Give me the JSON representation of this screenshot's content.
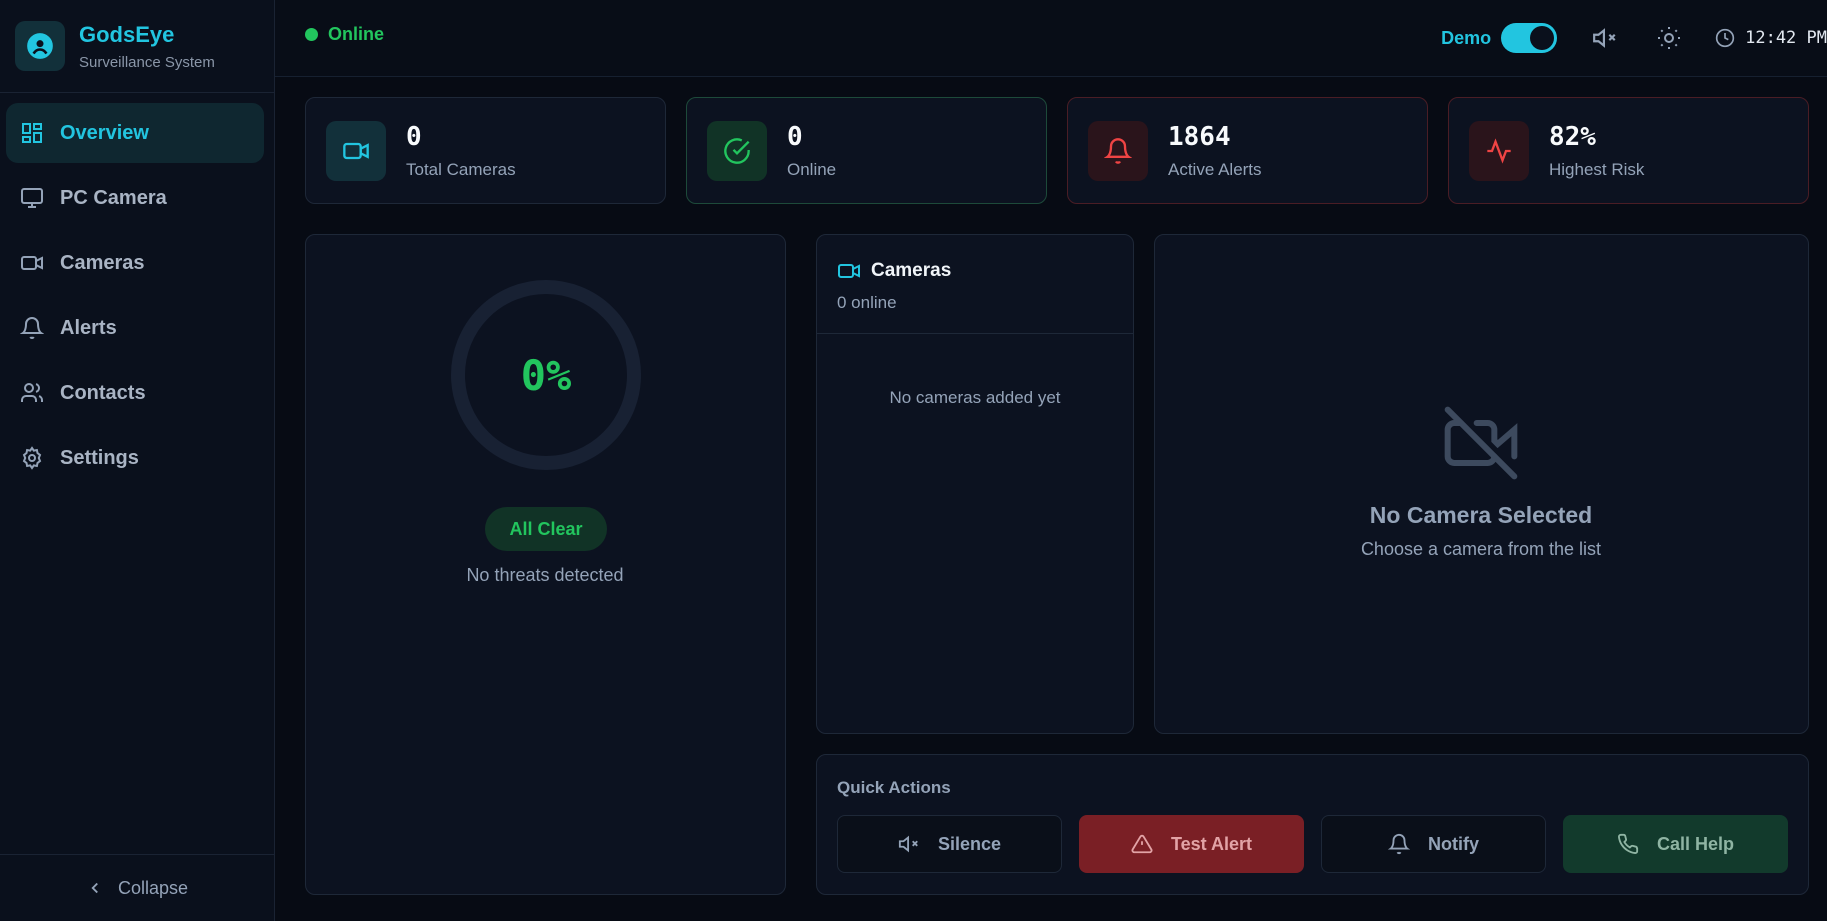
{
  "brand": {
    "name": "GodsEye",
    "subtitle": "Surveillance System"
  },
  "nav": [
    {
      "label": "Overview",
      "icon": "layout-grid-icon",
      "active": true
    },
    {
      "label": "PC Camera",
      "icon": "monitor-icon"
    },
    {
      "label": "Cameras",
      "icon": "video-icon"
    },
    {
      "label": "Alerts",
      "icon": "bell-icon"
    },
    {
      "label": "Contacts",
      "icon": "users-icon"
    },
    {
      "label": "Settings",
      "icon": "gear-icon"
    }
  ],
  "collapse_label": "Collapse",
  "header": {
    "status": "Online",
    "demo_label": "Demo",
    "demo_enabled": true,
    "time": "12:42 PM"
  },
  "stats": [
    {
      "value": "0",
      "label": "Total Cameras",
      "icon": "video-icon",
      "color": "#22c5e0"
    },
    {
      "value": "0",
      "label": "Online",
      "icon": "check-circle-icon",
      "color": "#22c55e"
    },
    {
      "value": "1864",
      "label": "Active Alerts",
      "icon": "bell-icon",
      "color": "#ef4444"
    },
    {
      "value": "82%",
      "label": "Highest Risk",
      "icon": "activity-icon",
      "color": "#ef4444"
    }
  ],
  "threat": {
    "percent_text": "0%",
    "level": 0,
    "status": "All Clear",
    "message": "No threats detected"
  },
  "cameras": {
    "title": "Cameras",
    "online_text": "0 online",
    "empty_text": "No cameras added yet"
  },
  "viewer": {
    "title": "No Camera Selected",
    "subtitle": "Choose a camera from the list"
  },
  "quick_actions": {
    "title": "Quick Actions",
    "buttons": [
      {
        "label": "Silence",
        "icon": "volume-x-icon"
      },
      {
        "label": "Test Alert",
        "icon": "alert-triangle-icon"
      },
      {
        "label": "Notify",
        "icon": "bell-icon"
      },
      {
        "label": "Call Help",
        "icon": "phone-icon"
      }
    ]
  },
  "colors": {
    "accent": "#22c5e0",
    "success": "#22c55e",
    "danger": "#ef4444",
    "background": "#070b14"
  }
}
